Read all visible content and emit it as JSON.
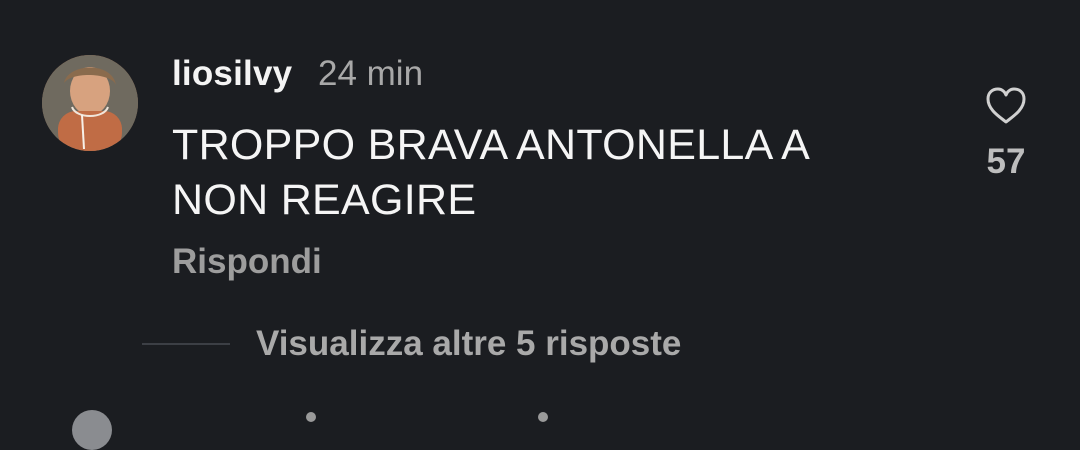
{
  "comment": {
    "username": "liosilvy",
    "timestamp": "24 min",
    "text_line1": "TROPPO BRAVA ANTONELLA A",
    "text_line2": "NON REAGIRE",
    "reply_label": "Rispondi",
    "like_count": "57",
    "avatar_icon": "user-avatar-photo",
    "like_icon": "heart-outline-icon"
  },
  "replies": {
    "view_more_label": "Visualizza altre 5 risposte"
  },
  "colors": {
    "background": "#1b1d21",
    "primary_text": "#f4f4f4",
    "secondary_text": "#a8a8a8"
  }
}
